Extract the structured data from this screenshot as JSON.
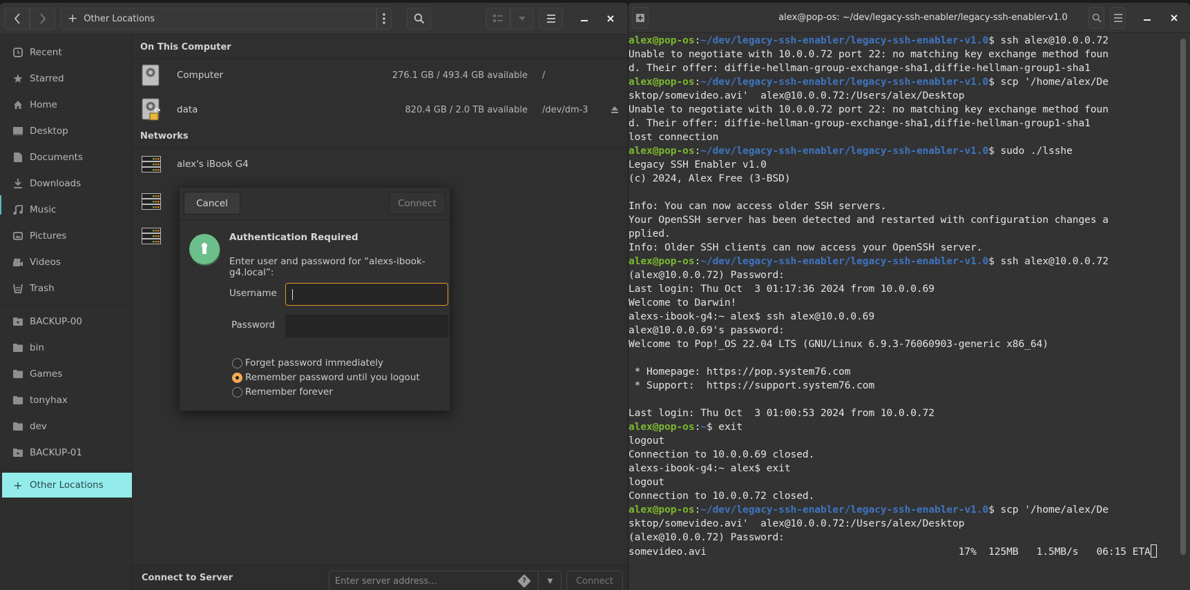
{
  "file_manager": {
    "location": "Other Locations",
    "sidebar": {
      "places": [
        {
          "label": "Recent",
          "icon": "clock-icon"
        },
        {
          "label": "Starred",
          "icon": "star-icon"
        },
        {
          "label": "Home",
          "icon": "home-icon"
        },
        {
          "label": "Desktop",
          "icon": "desktop-icon"
        },
        {
          "label": "Documents",
          "icon": "document-icon"
        },
        {
          "label": "Downloads",
          "icon": "download-icon"
        },
        {
          "label": "Music",
          "icon": "music-icon"
        },
        {
          "label": "Pictures",
          "icon": "pictures-icon"
        },
        {
          "label": "Videos",
          "icon": "video-icon"
        },
        {
          "label": "Trash",
          "icon": "trash-icon"
        }
      ],
      "bookmarks": [
        {
          "label": "BACKUP-00",
          "icon": "drive-folder-icon"
        },
        {
          "label": "bin",
          "icon": "folder-icon"
        },
        {
          "label": "Games",
          "icon": "folder-icon"
        },
        {
          "label": "tonyhax",
          "icon": "folder-icon"
        },
        {
          "label": "dev",
          "icon": "folder-icon"
        },
        {
          "label": "BACKUP-01",
          "icon": "drive-folder-icon"
        }
      ],
      "other_locations": "Other Locations"
    },
    "sections": {
      "on_this_computer": {
        "title": "On This Computer",
        "items": [
          {
            "name": "Computer",
            "info": "276.1 GB / 493.4 GB available",
            "path": "/"
          },
          {
            "name": "data",
            "info": "820.4 GB / 2.0 TB available",
            "path": "/dev/dm-3"
          }
        ]
      },
      "networks": {
        "title": "Networks",
        "items": [
          {
            "name": "alex's iBook G4"
          },
          {
            "name": ""
          },
          {
            "name": ""
          }
        ]
      }
    },
    "bottom_bar": {
      "label": "Connect to Server",
      "placeholder": "Enter server address…",
      "connect": "Connect"
    },
    "dialog": {
      "cancel": "Cancel",
      "connect": "Connect",
      "title": "Authentication Required",
      "message": "Enter user and password for “alexs-ibook-g4.local”:",
      "username_label": "Username",
      "username_value": "",
      "password_label": "Password",
      "password_value": "",
      "options": [
        {
          "label": "Forget password immediately",
          "selected": false
        },
        {
          "label": "Remember password until you logout",
          "selected": true
        },
        {
          "label": "Remember forever",
          "selected": false
        }
      ]
    }
  },
  "terminal": {
    "title": "alex@pop-os: ~/dev/legacy-ssh-enabler/legacy-ssh-enabler-v1.0",
    "prompt_user": "alex@pop-os",
    "prompt_path": "~/dev/legacy-ssh-enabler/legacy-ssh-enabler-v1.0",
    "lines": [
      {
        "type": "prompt",
        "path": "~/dev/legacy-ssh-enabler/legacy-ssh-enabler-v1.0",
        "cmd": "$ ssh alex@10.0.0.72"
      },
      {
        "type": "out",
        "text": "Unable to negotiate with 10.0.0.72 port 22: no matching key exchange method foun"
      },
      {
        "type": "out",
        "text": "d. Their offer: diffie-hellman-group-exchange-sha1,diffie-hellman-group1-sha1"
      },
      {
        "type": "prompt",
        "path": "~/dev/legacy-ssh-enabler/legacy-ssh-enabler-v1.0",
        "cmd": "$ scp '/home/alex/De"
      },
      {
        "type": "out",
        "text": "sktop/somevideo.avi'  alex@10.0.0.72:/Users/alex/Desktop"
      },
      {
        "type": "out",
        "text": "Unable to negotiate with 10.0.0.72 port 22: no matching key exchange method foun"
      },
      {
        "type": "out",
        "text": "d. Their offer: diffie-hellman-group-exchange-sha1,diffie-hellman-group1-sha1"
      },
      {
        "type": "out",
        "text": "lost connection"
      },
      {
        "type": "prompt",
        "path": "~/dev/legacy-ssh-enabler/legacy-ssh-enabler-v1.0",
        "cmd": "$ sudo ./lsshe"
      },
      {
        "type": "out",
        "text": "Legacy SSH Enabler v1.0"
      },
      {
        "type": "out",
        "text": "(c) 2024, Alex Free (3-BSD)"
      },
      {
        "type": "out",
        "text": ""
      },
      {
        "type": "out",
        "text": "Info: You can now access older SSH servers."
      },
      {
        "type": "out",
        "text": "Your OpenSSH server has been detected and restarted with configuration changes a"
      },
      {
        "type": "out",
        "text": "pplied."
      },
      {
        "type": "out",
        "text": "Info: Older SSH clients can now access your OpenSSH server."
      },
      {
        "type": "prompt",
        "path": "~/dev/legacy-ssh-enabler/legacy-ssh-enabler-v1.0",
        "cmd": "$ ssh alex@10.0.0.72"
      },
      {
        "type": "out",
        "text": "(alex@10.0.0.72) Password:"
      },
      {
        "type": "out",
        "text": "Last login: Thu Oct  3 01:17:36 2024 from 10.0.0.69"
      },
      {
        "type": "out",
        "text": "Welcome to Darwin!"
      },
      {
        "type": "out",
        "text": "alexs-ibook-g4:~ alex$ ssh alex@10.0.0.69"
      },
      {
        "type": "out",
        "text": "alex@10.0.0.69's password:"
      },
      {
        "type": "out",
        "text": "Welcome to Pop!_OS 22.04 LTS (GNU/Linux 6.9.3-76060903-generic x86_64)"
      },
      {
        "type": "out",
        "text": ""
      },
      {
        "type": "out",
        "text": " * Homepage: https://pop.system76.com"
      },
      {
        "type": "out",
        "text": " * Support:  https://support.system76.com"
      },
      {
        "type": "out",
        "text": ""
      },
      {
        "type": "out",
        "text": "Last login: Thu Oct  3 01:00:53 2024 from 10.0.0.72"
      },
      {
        "type": "prompt",
        "path": "~",
        "cmd": "$ exit"
      },
      {
        "type": "out",
        "text": "logout"
      },
      {
        "type": "out",
        "text": "Connection to 10.0.0.69 closed."
      },
      {
        "type": "out",
        "text": "alexs-ibook-g4:~ alex$ exit"
      },
      {
        "type": "out",
        "text": "logout"
      },
      {
        "type": "out",
        "text": "Connection to 10.0.0.72 closed."
      },
      {
        "type": "prompt",
        "path": "~/dev/legacy-ssh-enabler/legacy-ssh-enabler-v1.0",
        "cmd": "$ scp '/home/alex/De"
      },
      {
        "type": "out",
        "text": "sktop/somevideo.avi'  alex@10.0.0.72:/Users/alex/Desktop"
      },
      {
        "type": "out",
        "text": "(alex@10.0.0.72) Password:"
      },
      {
        "type": "progress",
        "text": "somevideo.avi                                          17%  125MB   1.5MB/s   06:15 ETA"
      }
    ],
    "transfer": {
      "file": "somevideo.avi",
      "percent": 17,
      "size": "125MB",
      "rate": "1.5MB/s",
      "eta": "06:15 ETA"
    }
  }
}
